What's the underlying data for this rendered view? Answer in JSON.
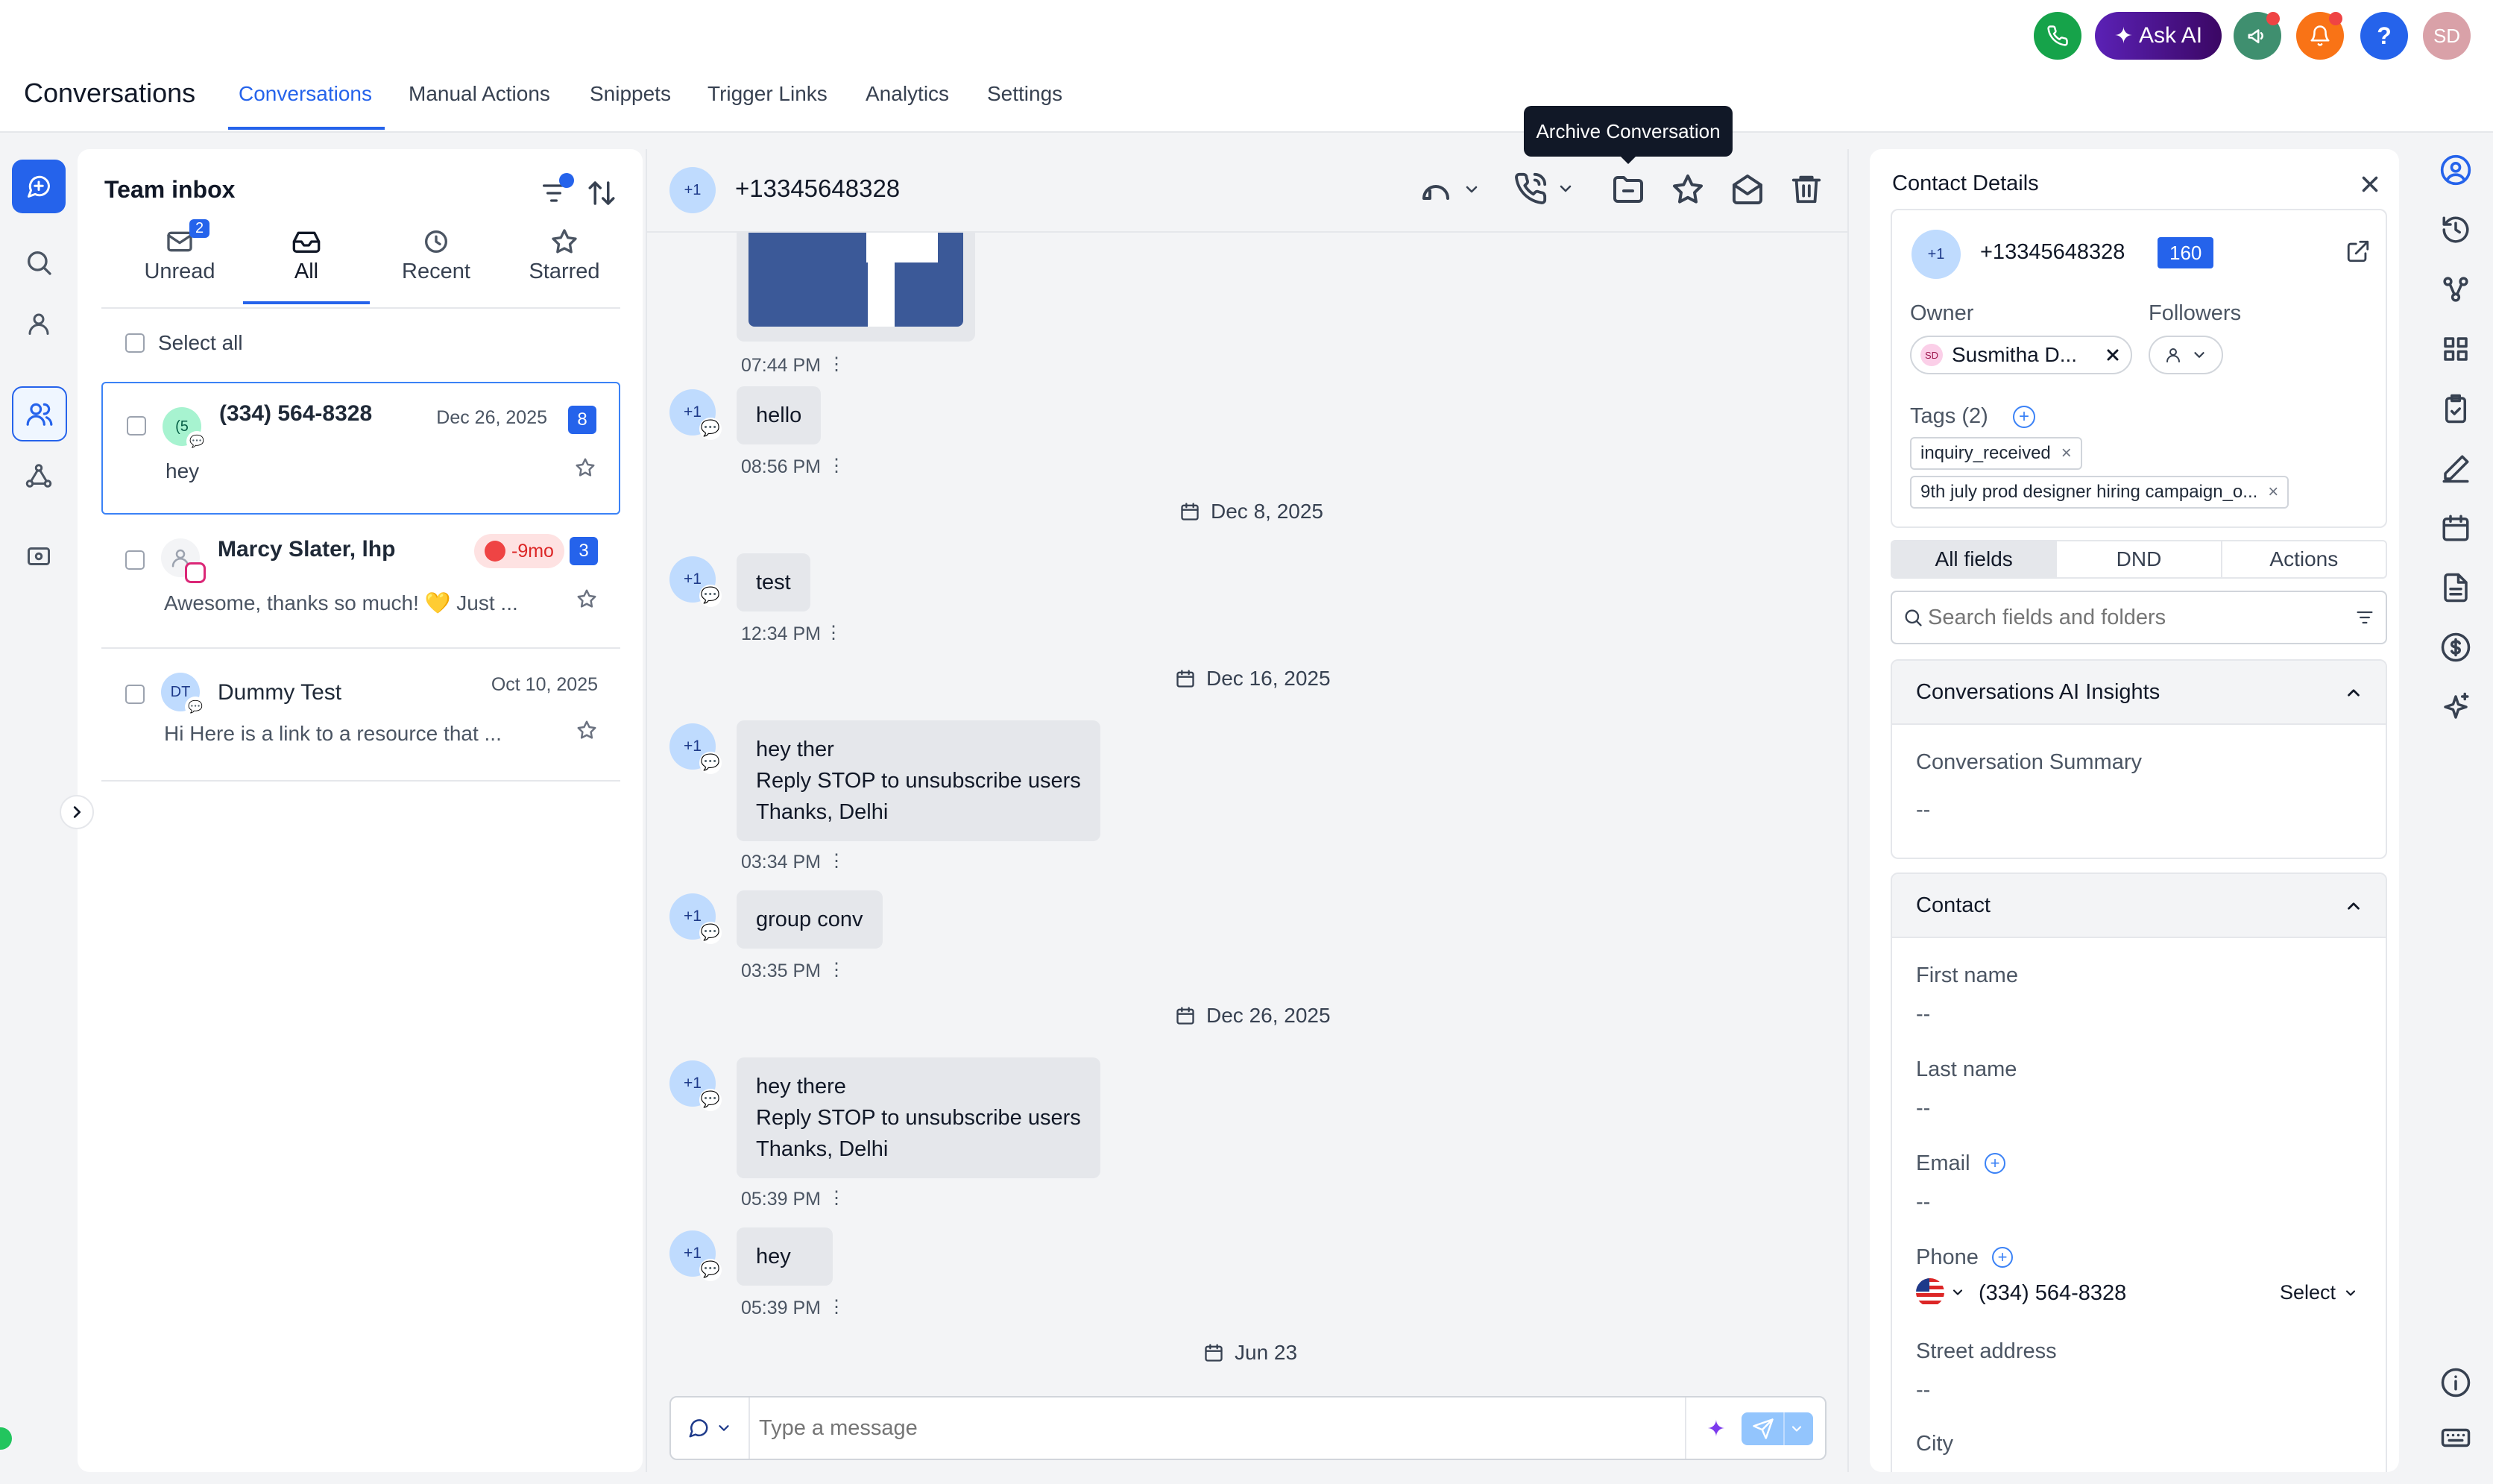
{
  "topbar": {
    "ask_ai_label": "Ask AI",
    "help_label": "?",
    "avatar_initials": "SD",
    "colors": {
      "phone": "#16a34a",
      "ask_ai": "#4c1d95",
      "announce": "#3f8f6f",
      "bell": "#f97316",
      "help": "#2563eb",
      "avatar": "#d9a1a8"
    }
  },
  "nav": {
    "app_title": "Conversations",
    "tabs": [
      "Conversations",
      "Manual Actions",
      "Snippets",
      "Trigger Links",
      "Analytics",
      "Settings"
    ],
    "active_tab": "Conversations"
  },
  "inbox": {
    "title": "Team inbox",
    "tabs": [
      {
        "label": "Unread",
        "icon": "mail-icon",
        "badge": "2"
      },
      {
        "label": "All",
        "icon": "inbox-icon"
      },
      {
        "label": "Recent",
        "icon": "clock-icon"
      },
      {
        "label": "Starred",
        "icon": "star-icon"
      }
    ],
    "active_tab": "All",
    "select_all_label": "Select all",
    "conversations": [
      {
        "avatar": "(5",
        "name": "(334) 564-8328",
        "date": "Dec 26, 2025",
        "preview": "hey",
        "count": "8",
        "channel": "sms"
      },
      {
        "avatar": "",
        "name": "Marcy Slater, lhp",
        "date": "",
        "overdue": "-9mo",
        "preview": "Awesome, thanks so much! 💛 Just ...",
        "count": "3",
        "channel": "instagram"
      },
      {
        "avatar": "DT",
        "name": "Dummy Test",
        "date": "Oct 10, 2025",
        "preview": "Hi Here is a link to a resource that ...",
        "count": "",
        "channel": "sms"
      }
    ]
  },
  "chat": {
    "contact_avatar": "+1",
    "contact_phone": "+13345648328",
    "tooltip": "Archive Conversation",
    "messages": [
      {
        "type": "image",
        "time": "07:44 PM"
      },
      {
        "type": "text",
        "avatar": "+1",
        "text": [
          "hello"
        ],
        "time": "08:56 PM"
      },
      {
        "type": "date",
        "text": "Dec 8, 2025"
      },
      {
        "type": "text",
        "avatar": "+1",
        "text": [
          "test"
        ],
        "time": "12:34 PM"
      },
      {
        "type": "date",
        "text": "Dec 16, 2025"
      },
      {
        "type": "text",
        "avatar": "+1",
        "text": [
          "hey ther",
          "Reply STOP to unsubscribe users",
          "Thanks, Delhi"
        ],
        "time": "03:34 PM"
      },
      {
        "type": "text",
        "avatar": "+1",
        "text": [
          "group conv"
        ],
        "time": "03:35 PM"
      },
      {
        "type": "date",
        "text": "Dec 26, 2025"
      },
      {
        "type": "text",
        "avatar": "+1",
        "text": [
          "hey there",
          "Reply STOP to unsubscribe users",
          "Thanks, Delhi"
        ],
        "time": "05:39 PM"
      },
      {
        "type": "text",
        "avatar": "+1",
        "text": [
          "hey"
        ],
        "time": "05:39 PM"
      },
      {
        "type": "date",
        "text": "Jun 23"
      }
    ],
    "composer_placeholder": "Type a message",
    "image_colors": {
      "fb_blue": "#3b5998"
    }
  },
  "contact": {
    "title": "Contact Details",
    "avatar": "+1",
    "phone": "+13345648328",
    "id_badge": "160",
    "owner_label": "Owner",
    "owner_name": "Susmitha D...",
    "owner_initials": "SD",
    "followers_label": "Followers",
    "tags_label": "Tags (2)",
    "tags": [
      "inquiry_received",
      "9th july prod designer hiring campaign_o..."
    ],
    "tabs": [
      "All fields",
      "DND",
      "Actions"
    ],
    "active_tab": "All fields",
    "search_placeholder": "Search fields and folders",
    "ai_section": {
      "title": "Conversations AI Insights",
      "summary_label": "Conversation Summary",
      "summary_value": "--"
    },
    "contact_section": {
      "title": "Contact",
      "fields": [
        {
          "label": "First name",
          "value": "--"
        },
        {
          "label": "Last name",
          "value": "--"
        },
        {
          "label": "Email",
          "value": "--"
        },
        {
          "label": "Phone",
          "value": "(334) 564-8328"
        },
        {
          "label": "Street address",
          "value": "--"
        },
        {
          "label": "City",
          "value": ""
        }
      ],
      "phone_select": "Select"
    }
  }
}
